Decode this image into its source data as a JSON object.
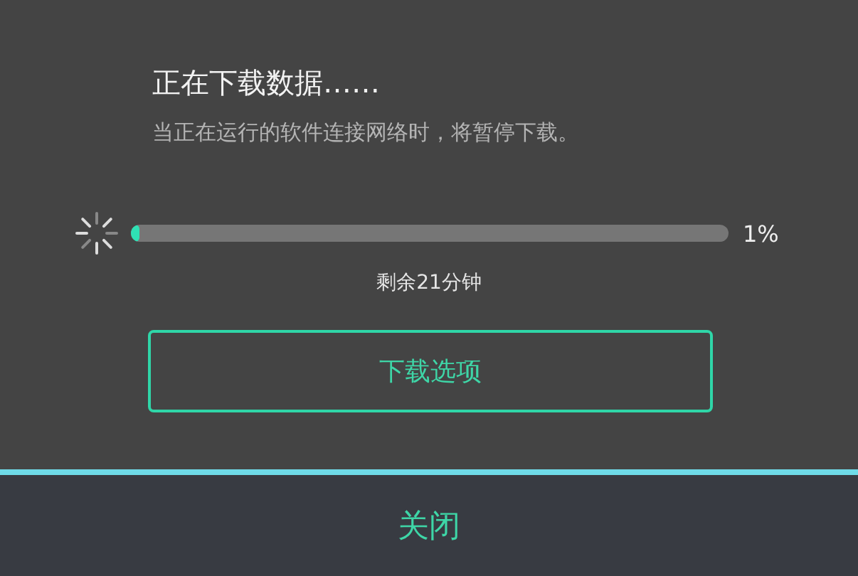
{
  "dialog": {
    "title": "正在下载数据……",
    "message": "当正在运行的软件连接网络时，将暂停下载。",
    "progress": {
      "level": 0.01,
      "percent": "1%",
      "remaining": "剩余21分钟"
    },
    "options_button": "下载选项"
  },
  "footer": {
    "close_button": "关闭"
  }
}
